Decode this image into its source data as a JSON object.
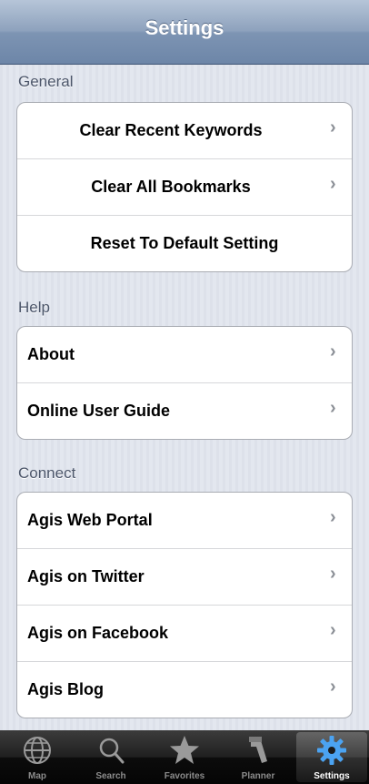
{
  "navbar": {
    "title": "Settings"
  },
  "sections": {
    "general": {
      "header": "General",
      "items": [
        "Clear Recent Keywords",
        "Clear All Bookmarks",
        "Reset To Default Setting"
      ]
    },
    "help": {
      "header": "Help",
      "items": [
        "About",
        "Online User Guide"
      ]
    },
    "connect": {
      "header": "Connect",
      "items": [
        "Agis Web Portal",
        "Agis on Twitter",
        "Agis on Facebook",
        "Agis Blog"
      ]
    }
  },
  "tabbar": {
    "tabs": [
      {
        "label": "Map",
        "icon": "globe-icon"
      },
      {
        "label": "Search",
        "icon": "magnifier-icon"
      },
      {
        "label": "Favorites",
        "icon": "star-icon"
      },
      {
        "label": "Planner",
        "icon": "planner-icon"
      },
      {
        "label": "Settings",
        "icon": "gear-icon",
        "active": true
      }
    ]
  },
  "colors": {
    "accent": "#4ba3f2",
    "navbar": "#7d94b3"
  }
}
